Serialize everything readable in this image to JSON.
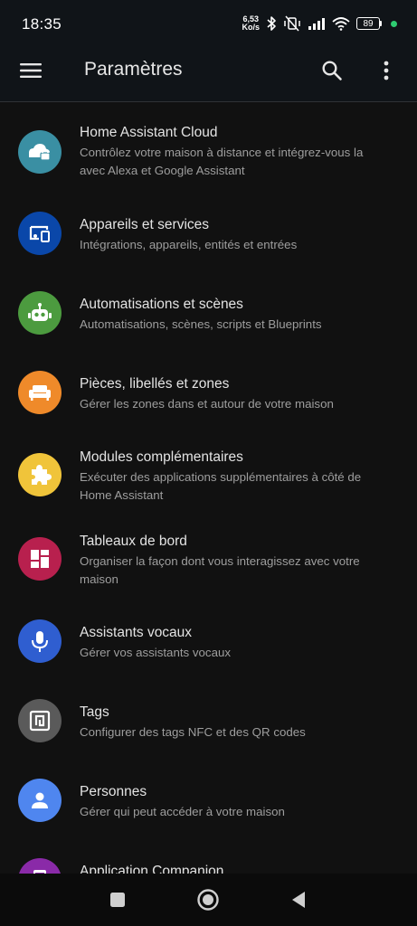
{
  "status": {
    "time": "18:35",
    "speed_value": "6,53",
    "speed_unit": "Ko/s",
    "battery": "89"
  },
  "app_bar": {
    "title": "Paramètres"
  },
  "items": [
    {
      "label": "Home Assistant Cloud",
      "desc": "Contrôlez votre maison à distance et intégrez-vous la avec Alexa et Google Assistant",
      "color": "#3a8fa3",
      "icon": "cloud-lock-icon"
    },
    {
      "label": "Appareils et services",
      "desc": "Intégrations, appareils, entités et entrées",
      "color": "#0a47a9",
      "icon": "devices-icon"
    },
    {
      "label": "Automatisations et scènes",
      "desc": "Automatisations, scènes, scripts et Blueprints",
      "color": "#4c9b3f",
      "icon": "robot-icon"
    },
    {
      "label": "Pièces, libellés et zones",
      "desc": "Gérer les zones dans et autour de votre maison",
      "color": "#ef8a2a",
      "icon": "sofa-icon"
    },
    {
      "label": "Modules complémentaires",
      "desc": "Exécuter des applications supplémentaires à côté de Home Assistant",
      "color": "#f0c43a",
      "icon": "puzzle-icon"
    },
    {
      "label": "Tableaux de bord",
      "desc": "Organiser la façon dont vous interagissez avec votre maison",
      "color": "#b8204e",
      "icon": "dashboard-icon"
    },
    {
      "label": "Assistants vocaux",
      "desc": "Gérer vos assistants vocaux",
      "color": "#2f5ed0",
      "icon": "microphone-icon"
    },
    {
      "label": "Tags",
      "desc": "Configurer des tags NFC et des QR codes",
      "color": "#5a5a5a",
      "icon": "nfc-tag-icon"
    },
    {
      "label": "Personnes",
      "desc": "Gérer qui peut accéder à votre maison",
      "color": "#4f86ef",
      "icon": "person-icon"
    },
    {
      "label": "Application Companion",
      "desc": "",
      "color": "#8a2aa8",
      "icon": "cellphone-icon"
    }
  ]
}
